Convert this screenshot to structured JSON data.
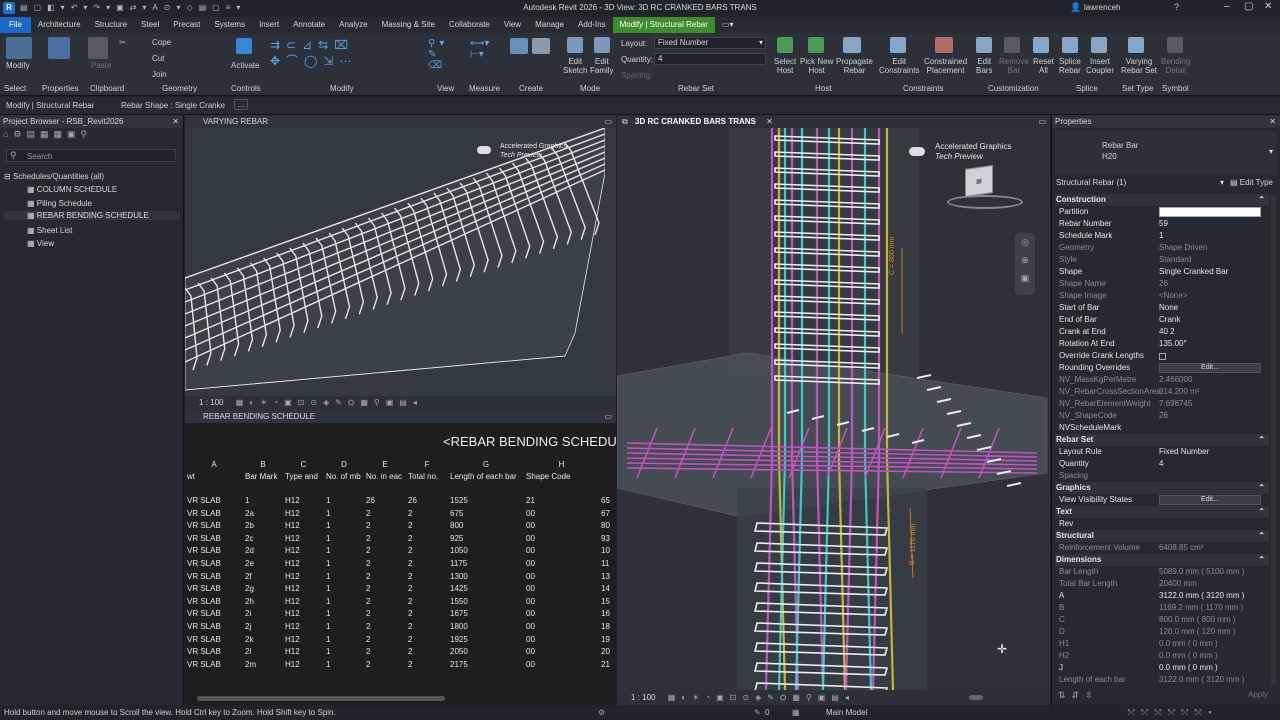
{
  "app": {
    "title": "Autodesk Revit 2026 - 3D View: 3D RC CRANKED BARS TRANS",
    "user": "lawrenceh"
  },
  "menu": [
    "File",
    "Architecture",
    "Structure",
    "Steel",
    "Precast",
    "Systems",
    "Insert",
    "Annotate",
    "Analyze",
    "Massing & Site",
    "Collaborate",
    "View",
    "Manage",
    "Add-Ins",
    "Modify | Structural Rebar"
  ],
  "ribbon": {
    "modify": "Modify",
    "select": "Select",
    "properties": "Properties",
    "paste": "Paste",
    "clipboard": "Clipboard",
    "cope": "Cope",
    "cut": "Cut",
    "join": "Join",
    "geometry": "Geometry",
    "activate": "Activate",
    "controls": "Controls",
    "modify_group": "Modify",
    "view": "View",
    "measure": "Measure",
    "create": "Create",
    "edit_sketch": [
      "Edit",
      "Sketch"
    ],
    "edit_family": [
      "Edit",
      "Family"
    ],
    "mode": "Mode",
    "layout_label": "Layout:",
    "layout_value": "Fixed Number",
    "quantity_label": "Quantity:",
    "quantity_value": "4",
    "spacing_label": "Spacing:",
    "rebar_set": "Rebar Set",
    "select_host": [
      "Select",
      "Host"
    ],
    "pick_new_host": [
      "Pick New",
      "Host"
    ],
    "propagate_rebar": [
      "Propagate",
      "Rebar"
    ],
    "host": "Host",
    "edit_constraints": [
      "Edit",
      "Constraints"
    ],
    "constrained_placement": [
      "Constrained",
      "Placement"
    ],
    "constraints": "Constraints",
    "edit_bars": [
      "Edit",
      "Bars"
    ],
    "remove_bar": [
      "Remove",
      "Bar"
    ],
    "reset_all": [
      "Reset",
      "All"
    ],
    "customization": "Customization",
    "splice_rebar": [
      "Splice",
      "Rebar"
    ],
    "insert_coupler": [
      "Insert",
      "Coupler"
    ],
    "splice": "Splice",
    "varying_rebar_set": [
      "Varying",
      "Rebar Set"
    ],
    "set_type": "Set Type",
    "bending_detail": [
      "Bending",
      "Detail"
    ],
    "symbol": "Symbol"
  },
  "optbar": {
    "context": "Modify | Structural Rebar",
    "rebar_shape": "Rebar Shape : Single Cranke"
  },
  "project_browser": {
    "title": "Project Browser - RSB_Revit2026",
    "search": "Search",
    "root": "Schedules/Quantities (all)",
    "items": [
      "COLUMN SCHEDULE",
      "Piling Schedule",
      "REBAR BENDING SCHEDULE",
      "Sheet List",
      "View"
    ]
  },
  "viewports": {
    "varying": {
      "title": "VARYING REBAR",
      "scale": "1 : 100",
      "accel1": "Accelerated Graphics",
      "accel2": "Tech Preview"
    },
    "schedule": {
      "title": "REBAR BENDING SCHEDULE",
      "heading": "<REBAR BENDING SCHEDUL"
    },
    "main3d": {
      "title": "3D RC CRANKED BARS TRANS",
      "scale": "1 : 100",
      "accel1": "Accelerated Graphics",
      "accel2": "Tech Preview",
      "dim_c": "C = 800 mm",
      "dim_b": "B = 1170 mm"
    }
  },
  "schedule": {
    "letters": [
      "A",
      "B",
      "C",
      "D",
      "E",
      "F",
      "G",
      "H"
    ],
    "headers": [
      "wt",
      "Bar Mark",
      "Type and",
      "No. of mb",
      "No. in eac",
      "Total no.",
      "Length of each bar",
      "Shape Code",
      ""
    ],
    "rows": [
      [
        "VR SLAB",
        "1",
        "H12",
        "1",
        "26",
        "26",
        "1525",
        "21",
        "65"
      ],
      [
        "VR SLAB",
        "2a",
        "H12",
        "1",
        "2",
        "2",
        "675",
        "00",
        "67"
      ],
      [
        "VR SLAB",
        "2b",
        "H12",
        "1",
        "2",
        "2",
        "800",
        "00",
        "80"
      ],
      [
        "VR SLAB",
        "2c",
        "H12",
        "1",
        "2",
        "2",
        "925",
        "00",
        "93"
      ],
      [
        "VR SLAB",
        "2d",
        "H12",
        "1",
        "2",
        "2",
        "1050",
        "00",
        "10"
      ],
      [
        "VR SLAB",
        "2e",
        "H12",
        "1",
        "2",
        "2",
        "1175",
        "00",
        "11"
      ],
      [
        "VR SLAB",
        "2f",
        "H12",
        "1",
        "2",
        "2",
        "1300",
        "00",
        "13"
      ],
      [
        "VR SLAB",
        "2g",
        "H12",
        "1",
        "2",
        "2",
        "1425",
        "00",
        "14"
      ],
      [
        "VR SLAB",
        "2h",
        "H12",
        "1",
        "2",
        "2",
        "1550",
        "00",
        "15"
      ],
      [
        "VR SLAB",
        "2i",
        "H12",
        "1",
        "2",
        "2",
        "1675",
        "00",
        "16"
      ],
      [
        "VR SLAB",
        "2j",
        "H12",
        "1",
        "2",
        "2",
        "1800",
        "00",
        "18"
      ],
      [
        "VR SLAB",
        "2k",
        "H12",
        "1",
        "2",
        "2",
        "1925",
        "00",
        "19"
      ],
      [
        "VR SLAB",
        "2l",
        "H12",
        "1",
        "2",
        "2",
        "2050",
        "00",
        "20"
      ],
      [
        "VR SLAB",
        "2m",
        "H12",
        "1",
        "2",
        "2",
        "2175",
        "00",
        "21"
      ]
    ]
  },
  "properties": {
    "title": "Properties",
    "family": "Rebar Bar",
    "type": "H20",
    "selector": "Structural Rebar (1)",
    "edit_type": "Edit Type",
    "sections": [
      {
        "name": "Construction",
        "rows": [
          [
            "Partition",
            "",
            false,
            "box"
          ],
          [
            "Rebar Number",
            "59",
            false
          ],
          [
            "Schedule Mark",
            "1",
            false
          ],
          [
            "Geometry",
            "Shape Driven",
            true
          ],
          [
            "Style",
            "Standard",
            true
          ],
          [
            "Shape",
            "Single Cranked Bar",
            false
          ],
          [
            "Shape Name",
            "26",
            true
          ],
          [
            "Shape Image",
            "<None>",
            true
          ],
          [
            "Start of Bar",
            "None",
            false
          ],
          [
            "End of Bar",
            "Crank",
            false
          ],
          [
            "Crank at End",
            "40 2",
            false
          ],
          [
            "Rotation At End",
            "135.00°",
            false
          ],
          [
            "Override Crank Lengths",
            "",
            false,
            "check"
          ],
          [
            "Rounding Overrides",
            "Edit...",
            false,
            "btn"
          ],
          [
            "NV_MassKgPerMetre",
            "2.466000",
            true
          ],
          [
            "NV_RebarCrossSectionArea",
            "314.200 m²",
            true
          ],
          [
            "NV_RebarElementWeight",
            "7.698745",
            true
          ],
          [
            "NV_ShapeCode",
            "26",
            true
          ],
          [
            "NVScheduleMark",
            "",
            false
          ]
        ]
      },
      {
        "name": "Rebar Set",
        "rows": [
          [
            "Layout Rule",
            "Fixed Number",
            false
          ],
          [
            "Quantity",
            "4",
            false
          ],
          [
            "Spacing",
            "",
            true
          ]
        ]
      },
      {
        "name": "Graphics",
        "rows": [
          [
            "View Visibility States",
            "Edit...",
            false,
            "btn"
          ]
        ]
      },
      {
        "name": "Text",
        "rows": [
          [
            "Rev",
            "",
            false
          ]
        ]
      },
      {
        "name": "Structural",
        "rows": [
          [
            "Reinforcement Volume",
            "6408.85 cm³",
            true
          ]
        ]
      },
      {
        "name": "Dimensions",
        "rows": [
          [
            "Bar Length",
            "5089.0 mm ( 5100 mm )",
            true
          ],
          [
            "Total Bar Length",
            "20400 mm",
            true
          ],
          [
            "A",
            "3122.0 mm ( 3120 mm )",
            false
          ],
          [
            "B",
            "1169.2 mm ( 1170 mm )",
            true
          ],
          [
            "C",
            "800.0 mm ( 800 mm )",
            true
          ],
          [
            "D",
            "120.0 mm ( 120 mm )",
            true
          ],
          [
            "H1",
            "0.0 mm ( 0 mm )",
            true
          ],
          [
            "H2",
            "0.0 mm ( 0 mm )",
            true
          ],
          [
            "J",
            "0.0 mm ( 0 mm )",
            false
          ],
          [
            "Length of each bar",
            "3122.0 mm ( 3120 mm )",
            true
          ]
        ]
      }
    ],
    "apply": "Apply"
  },
  "status": {
    "hint": "Hold button and move mouse to Scroll the view. Hold Ctrl key to Zoom. Hold Shift key to Spin.",
    "zero": "0",
    "model": "Main Model"
  },
  "colors": {
    "accent": "#1869c8",
    "context_tab": "#3e8c2e",
    "rebar_pink": "#c055c0",
    "rebar_cyan": "#3ec8c8",
    "rebar_yellow": "#c8b43c",
    "dim_orange": "#e08a2a"
  }
}
